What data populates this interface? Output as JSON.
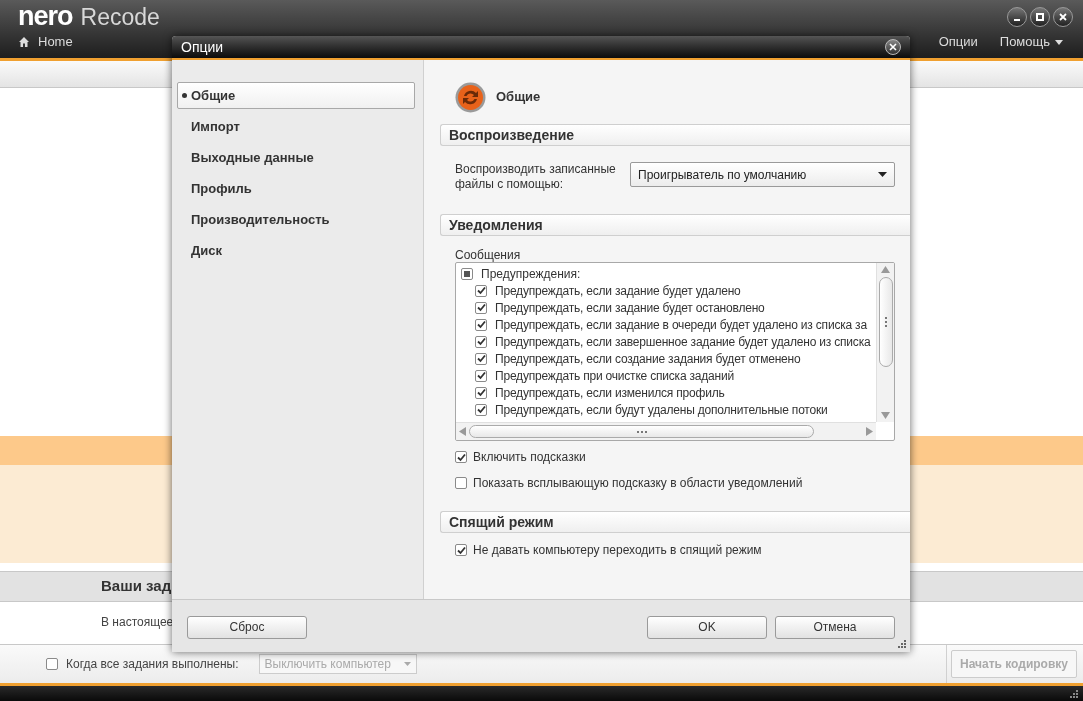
{
  "app": {
    "logo": "nero",
    "title": "Recode",
    "home": "Home",
    "menu": [
      {
        "label": "Опции",
        "dropdown": false
      },
      {
        "label": "Помощь",
        "dropdown": true
      }
    ]
  },
  "background": {
    "jobs_title": "Ваши зад",
    "jobs_message": "В настоящее",
    "when_done": {
      "label": "Когда все задания выполнены:",
      "checked": false
    },
    "shutdown_select": {
      "value": "Выключить компьютер",
      "disabled": true
    },
    "start_button": {
      "label": "Начать кодировку",
      "disabled": true
    }
  },
  "dialog": {
    "title": "Опции",
    "nav": [
      {
        "label": "Общие",
        "selected": true
      },
      {
        "label": "Импорт",
        "selected": false
      },
      {
        "label": "Выходные данные",
        "selected": false
      },
      {
        "label": "Профиль",
        "selected": false
      },
      {
        "label": "Производительность",
        "selected": false
      },
      {
        "label": "Диск",
        "selected": false
      }
    ],
    "page_title": "Общие",
    "playback": {
      "title": "Воспроизведение",
      "label": "Воспроизводить записанные файлы с помощью:",
      "select": "Проигрыватель по умолчанию"
    },
    "notifications": {
      "title": "Уведомления",
      "messages_label": "Сообщения",
      "messages": [
        {
          "label": "Предупреждения:",
          "indeterminate": true,
          "children": [
            {
              "label": "Предупреждать, если задание будет удалено",
              "checked": true
            },
            {
              "label": "Предупреждать, если задание будет остановлено",
              "checked": true
            },
            {
              "label": "Предупреждать, если задание в очереди будет удалено из списка за",
              "checked": true
            },
            {
              "label": "Предупреждать, если завершенное задание будет удалено из списка",
              "checked": true
            },
            {
              "label": "Предупреждать, если создание задания будет отменено",
              "checked": true
            },
            {
              "label": "Предупреждать при очистке списка заданий",
              "checked": true
            },
            {
              "label": "Предупреждать, если изменился профиль",
              "checked": true
            },
            {
              "label": "Предупреждать, если будут удалены дополнительные потоки",
              "checked": true
            }
          ]
        }
      ],
      "options": [
        {
          "label": "Включить подсказки",
          "checked": true
        },
        {
          "label": "Показать всплывающую подсказку в области уведомлений",
          "checked": false
        }
      ]
    },
    "sleep": {
      "title": "Спящий режим",
      "options": [
        {
          "label": "Не давать компьютеру переходить в спящий режим",
          "checked": true
        }
      ]
    },
    "buttons": {
      "reset": "Сброс",
      "ok": "OK",
      "cancel": "Отмена"
    }
  }
}
